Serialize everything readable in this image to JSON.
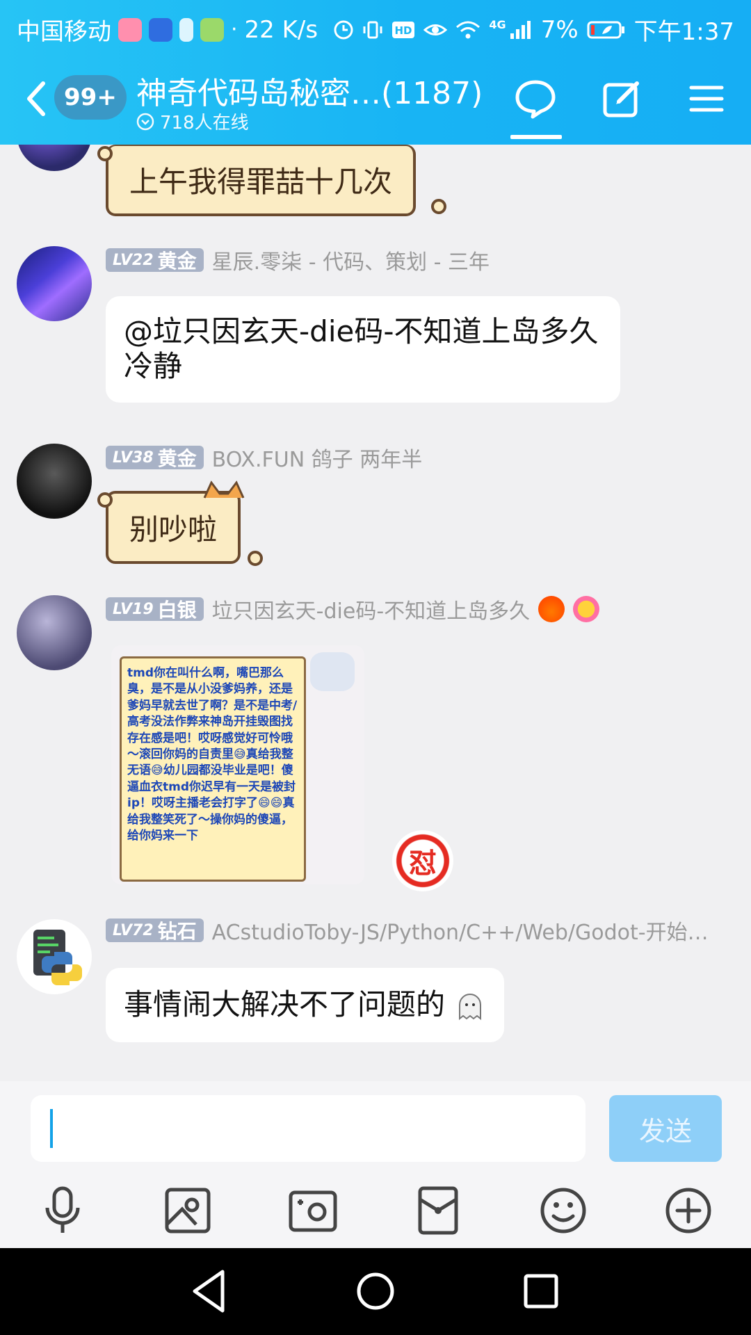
{
  "status_bar": {
    "carrier": "中国移动",
    "network_speed": "22 K/s",
    "network_type": "4G",
    "battery": "7%",
    "time": "下午1:37"
  },
  "header": {
    "unread_count": "99+",
    "title": "神奇代码岛秘密…(1187)",
    "online": "718人在线"
  },
  "messages": [
    {
      "type": "sticker-text",
      "text": "上午我得罪喆十几次"
    },
    {
      "type": "text",
      "level": "LV22",
      "rank": "黄金",
      "nickname": "星辰.零柒 - 代码、策划 - 三年",
      "text": "@垃只因玄天-die码-不知道上岛多久 冷静"
    },
    {
      "type": "sticker-text",
      "level": "LV38",
      "rank": "黄金",
      "nickname": "BOX.FUN 鸽子 两年半",
      "text": "别吵啦"
    },
    {
      "type": "image",
      "level": "LV19",
      "rank": "白银",
      "nickname": "垃只因玄天-die码-不知道上岛多久",
      "image_text": "tmd你在叫什么啊，嘴巴那么臭，是不是从小没爹妈养，还是爹妈早就去世了啊？是不是中考/高考没法作弊来神岛开挂毁图找存在感是吧！哎呀感觉好可怜哦～滚回你妈的自责里😅真给我整无语😅幼儿园都没毕业是吧！傻逼血衣tmd你迟早有一天是被封ip！哎呀主播老会打字了😄😄真给我整笑死了～操你妈的傻逼，给你妈来一下",
      "sticker_text": "怼"
    },
    {
      "type": "text",
      "level": "LV72",
      "rank": "钻石",
      "nickname": "ACstudioToby-JS/Python/C++/Web/Godot-开始…",
      "text": "事情闹大解决不了问题的"
    }
  ],
  "input": {
    "value": "",
    "send_label": "发送"
  },
  "colors": {
    "header_blue": "#1cb7f4",
    "badge_gray": "#a8b2c6",
    "send_disabled": "#8ecff8"
  }
}
